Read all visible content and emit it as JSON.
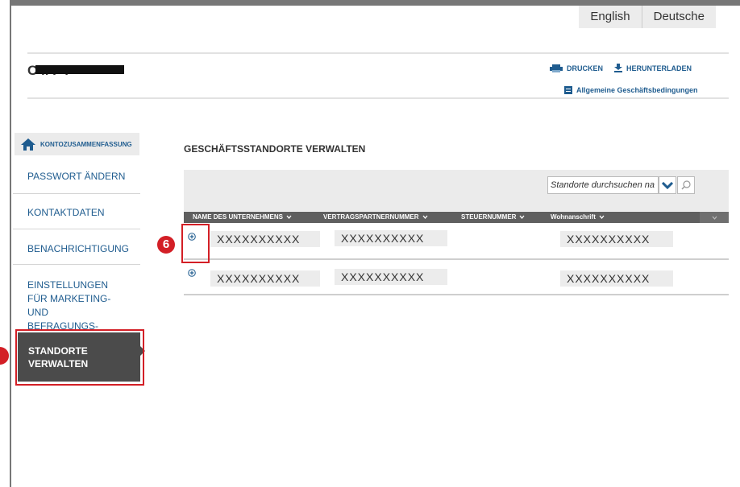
{
  "language": {
    "english": "English",
    "deutsch": "Deutsche"
  },
  "user": {
    "name": "C        li  F    l  "
  },
  "actions": {
    "print": "DRUCKEN",
    "download": "HERUNTERLADEN",
    "terms": "Allgemeine Geschäftsbedingungen"
  },
  "sidebar": {
    "home": "KONTOZUSAMMENFASSUNG",
    "items": [
      "PASSWORT ÄNDERN",
      "KONTAKTDATEN",
      "BENACHRICHTIGUNG",
      "EINSTELLUNGEN FÜR MARKETING- UND BEFRAGUNGS-EMAILS"
    ],
    "active": "STANDORTE VERWALTEN"
  },
  "main": {
    "title": "GESCHÄFTSSTANDORTE VERWALTEN",
    "search_placeholder": "Standorte durchsuchen na",
    "columns": [
      "NAME DES UNTERNEHMENS",
      "VERTRAGSPARTNERNUMMER",
      "STEUERNUMMER",
      "Wohnanschrift"
    ],
    "rows": [
      {
        "name": "XXXXXXXXXX",
        "contract": "XXXXXXXXXX",
        "tax": "",
        "address": "XXXXXXXXXX"
      },
      {
        "name": "XXXXXXXXXX",
        "contract": "XXXXXXXXXX",
        "tax": "",
        "address": "XXXXXXXXXX"
      }
    ]
  },
  "annotations": {
    "step": "6"
  },
  "colors": {
    "link": "#1f5c8f",
    "active_bg": "#4b4b4b",
    "highlight": "#d31f26"
  }
}
